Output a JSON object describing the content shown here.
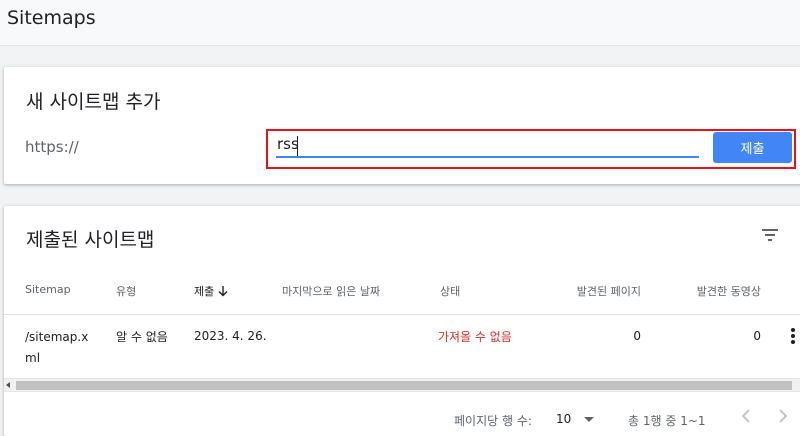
{
  "page": {
    "title": "Sitemaps"
  },
  "add_card": {
    "title": "새 사이트맵 추가",
    "url_prefix": "https://",
    "input_value": "rss",
    "submit_label": "제출"
  },
  "submitted_card": {
    "title": "제출된 사이트맵",
    "columns": {
      "sitemap": "Sitemap",
      "type": "유형",
      "submitted": "제출",
      "last_read": "마지막으로 읽은 날짜",
      "status": "상태",
      "pages": "발견된 페이지",
      "videos": "발견한 동영상"
    },
    "rows": [
      {
        "sitemap_line1": "/sitemap.x",
        "sitemap_line2": "ml",
        "type": "알 수 없음",
        "submitted": "2023. 4. 26.",
        "last_read": "",
        "status": "가져올 수 없음",
        "pages": "0",
        "videos": "0"
      }
    ],
    "pagination": {
      "rows_per_page_label": "페이지당 행 수:",
      "rows_per_page": "10",
      "range": "총 1행 중 1~1"
    }
  },
  "colors": {
    "accent": "#4285f4",
    "error": "#d93025",
    "highlight": "#e8101b"
  }
}
